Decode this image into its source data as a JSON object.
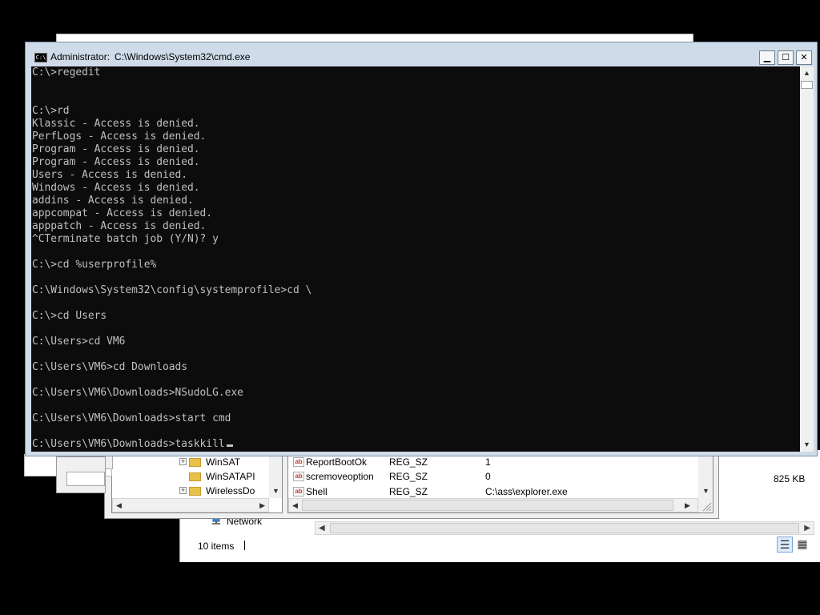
{
  "explorer": {
    "nav_network": "Network",
    "status_items": "10 items",
    "file_size": "825 KB"
  },
  "regedit": {
    "tree": [
      {
        "label": "WinSAT",
        "expandable": true
      },
      {
        "label": "WinSATAPI",
        "expandable": false
      },
      {
        "label": "WirelessDo",
        "expandable": true
      }
    ],
    "values": [
      {
        "name": "ReportBootOk",
        "type": "REG_SZ",
        "data": "1"
      },
      {
        "name": "scremoveoption",
        "type": "REG_SZ",
        "data": "0"
      },
      {
        "name": "Shell",
        "type": "REG_SZ",
        "data": "C:\\ass\\explorer.exe"
      }
    ]
  },
  "cmd": {
    "title_prefix": "Administrator:",
    "title_path": "C:\\Windows\\System32\\cmd.exe",
    "lines": [
      "C:\\>regedit",
      "",
      "",
      "C:\\>rd",
      "Klassic - Access is denied.",
      "PerfLogs - Access is denied.",
      "Program - Access is denied.",
      "Program - Access is denied.",
      "Users - Access is denied.",
      "Windows - Access is denied.",
      "addins - Access is denied.",
      "appcompat - Access is denied.",
      "apppatch - Access is denied.",
      "^CTerminate batch job (Y/N)? y",
      "",
      "C:\\>cd %userprofile%",
      "",
      "C:\\Windows\\System32\\config\\systemprofile>cd \\",
      "",
      "C:\\>cd Users",
      "",
      "C:\\Users>cd VM6",
      "",
      "C:\\Users\\VM6>cd Downloads",
      "",
      "C:\\Users\\VM6\\Downloads>NSudoLG.exe",
      "",
      "C:\\Users\\VM6\\Downloads>start cmd",
      ""
    ],
    "current_line": "C:\\Users\\VM6\\Downloads>taskkill"
  }
}
